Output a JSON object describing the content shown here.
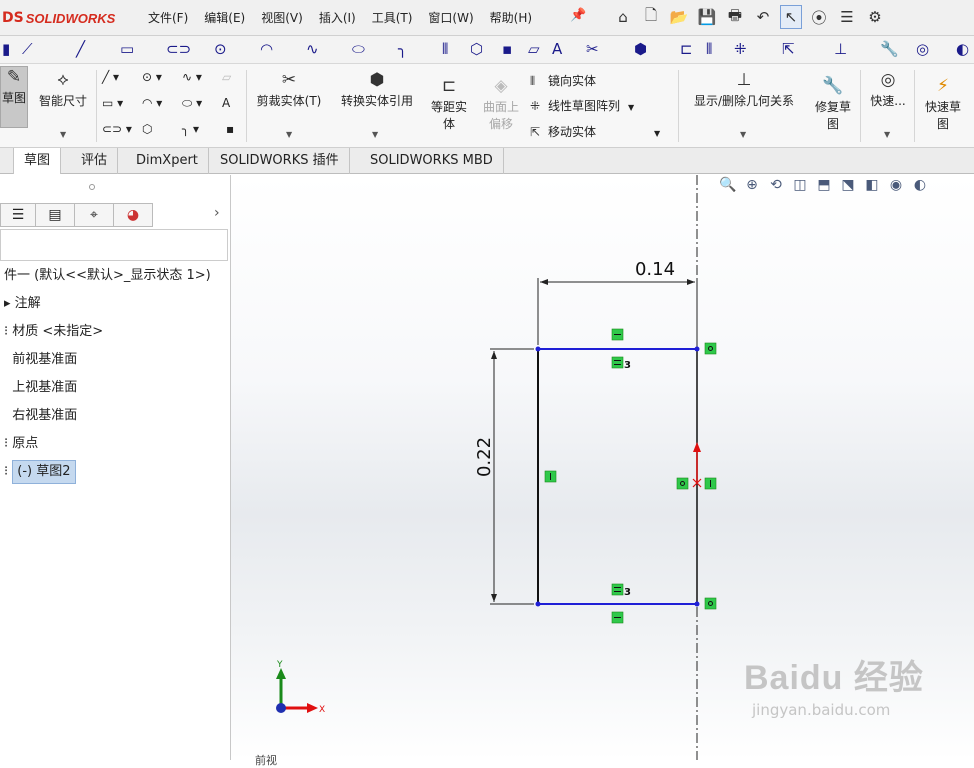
{
  "app": {
    "logo_mark": "DS",
    "logo_name": "SOLIDWORKS"
  },
  "menu": {
    "items": [
      "文件(F)",
      "编辑(E)",
      "视图(V)",
      "插入(I)",
      "工具(T)",
      "窗口(W)",
      "帮助(H)"
    ]
  },
  "toolbar_quick": {
    "icons": [
      "home-icon",
      "new-document-icon",
      "open-folder-icon",
      "save-icon",
      "print-icon",
      "undo-icon",
      "select-cursor-icon",
      "traffic-light-icon",
      "file-properties-icon",
      "gear-icon"
    ]
  },
  "ribbon": {
    "sketch": "草图",
    "smart_dimension": "智能尺寸",
    "trim": "剪裁实体(T)",
    "convert": "转换实体引用",
    "offset_line1": "等距实",
    "offset_line2": "体",
    "surface_line1": "曲面上",
    "surface_line2": "偏移",
    "mirror": "镜向实体",
    "linear_pattern": "线性草图阵列",
    "move": "移动实体",
    "relations": "显示/删除几何关系",
    "repair_line1": "修复草",
    "repair_line2": "图",
    "quick_snap": "快速...",
    "rapid_line1": "快速草",
    "rapid_line2": "图"
  },
  "tabs": {
    "items": [
      "草图",
      "评估",
      "DimXpert",
      "SOLIDWORKS 插件",
      "SOLIDWORKS MBD"
    ],
    "active": "草图"
  },
  "tree": {
    "part": "件一  (默认<<默认>_显示状态 1>)",
    "annotations": "注解",
    "material": "材质 <未指定>",
    "front_plane": "前视基准面",
    "top_plane": "上视基准面",
    "right_plane": "右视基准面",
    "origin": "原点",
    "sketch": "(-) 草图2"
  },
  "sketch": {
    "dim_width": "0.14",
    "dim_height": "0.22",
    "relation_equal_index": "3",
    "axis_x": "X",
    "axis_y": "Y"
  },
  "status": {
    "bottom_text": "前视"
  },
  "watermark": {
    "main": "Baidu 经验",
    "sub": "jingyan.baidu.com"
  },
  "colors": {
    "logo_red": "#d52b1e",
    "sketch_blue": "#1f1fd6",
    "relation_green": "#2fc84a",
    "axis_red": "#e01010",
    "axis_green": "#1a8a1a"
  }
}
